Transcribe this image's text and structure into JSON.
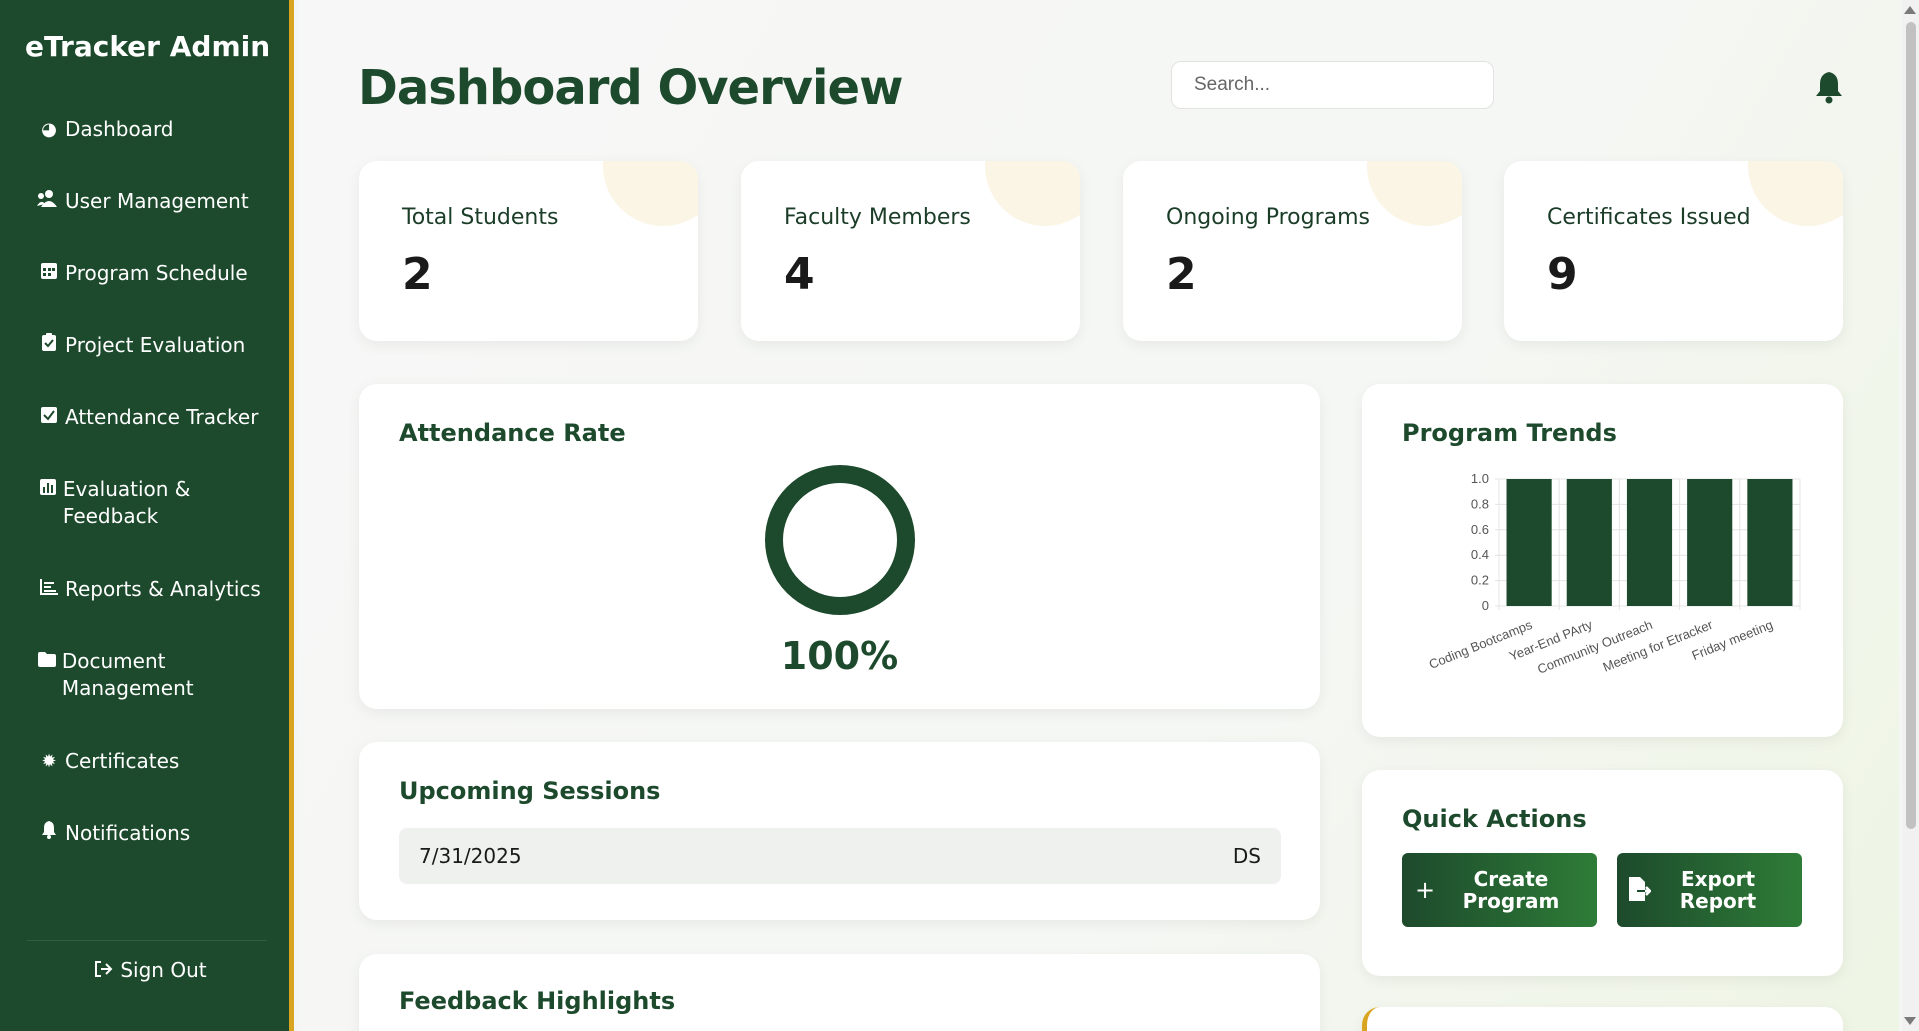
{
  "sidebar": {
    "brand": "eTracker Admin",
    "items": [
      {
        "label": "Dashboard",
        "icon": "dashboard-gauge-icon"
      },
      {
        "label": "User Management",
        "icon": "users-icon"
      },
      {
        "label": "Program Schedule",
        "icon": "calendar-icon"
      },
      {
        "label": "Project Evaluation",
        "icon": "clipboard-check-icon"
      },
      {
        "label": "Attendance Tracker",
        "icon": "checkbox-icon"
      },
      {
        "label": "Evaluation & Feedback",
        "icon": "poll-icon"
      },
      {
        "label": "Reports & Analytics",
        "icon": "chart-line-icon"
      },
      {
        "label": "Document Management",
        "icon": "folder-icon"
      },
      {
        "label": "Certificates",
        "icon": "certificate-icon"
      },
      {
        "label": "Notifications",
        "icon": "bell-icon"
      }
    ],
    "signout": "Sign Out"
  },
  "header": {
    "title": "Dashboard Overview",
    "search_placeholder": "Search..."
  },
  "stats": [
    {
      "label": "Total Students",
      "value": "2"
    },
    {
      "label": "Faculty Members",
      "value": "4"
    },
    {
      "label": "Ongoing Programs",
      "value": "2"
    },
    {
      "label": "Certificates Issued",
      "value": "9"
    }
  ],
  "attendance": {
    "title": "Attendance Rate",
    "percent_text": "100%",
    "rate": 1.0
  },
  "sessions": {
    "title": "Upcoming Sessions",
    "rows": [
      {
        "date": "7/31/2025",
        "code": "DS"
      }
    ]
  },
  "feedback": {
    "title": "Feedback Highlights"
  },
  "trends": {
    "title": "Program Trends"
  },
  "quick_actions": {
    "title": "Quick Actions",
    "create_label": "Create Program",
    "export_label": "Export Report"
  },
  "colors": {
    "primary": "#1d4a2c",
    "accent": "#d9a520",
    "button_gradient_end": "#2e7c37"
  },
  "chart_data": {
    "type": "bar",
    "categories": [
      "Coding Bootcamps",
      "Year-End PArty",
      "Community Outreach",
      "Meeting for Etracker",
      "Friday meeting"
    ],
    "values": [
      1,
      1,
      1,
      1,
      1
    ],
    "yticks": [
      "0",
      "0.2",
      "0.4",
      "0.6",
      "0.8",
      "1.0"
    ],
    "ylim": [
      0,
      1
    ],
    "grid": true,
    "legend": "none"
  }
}
